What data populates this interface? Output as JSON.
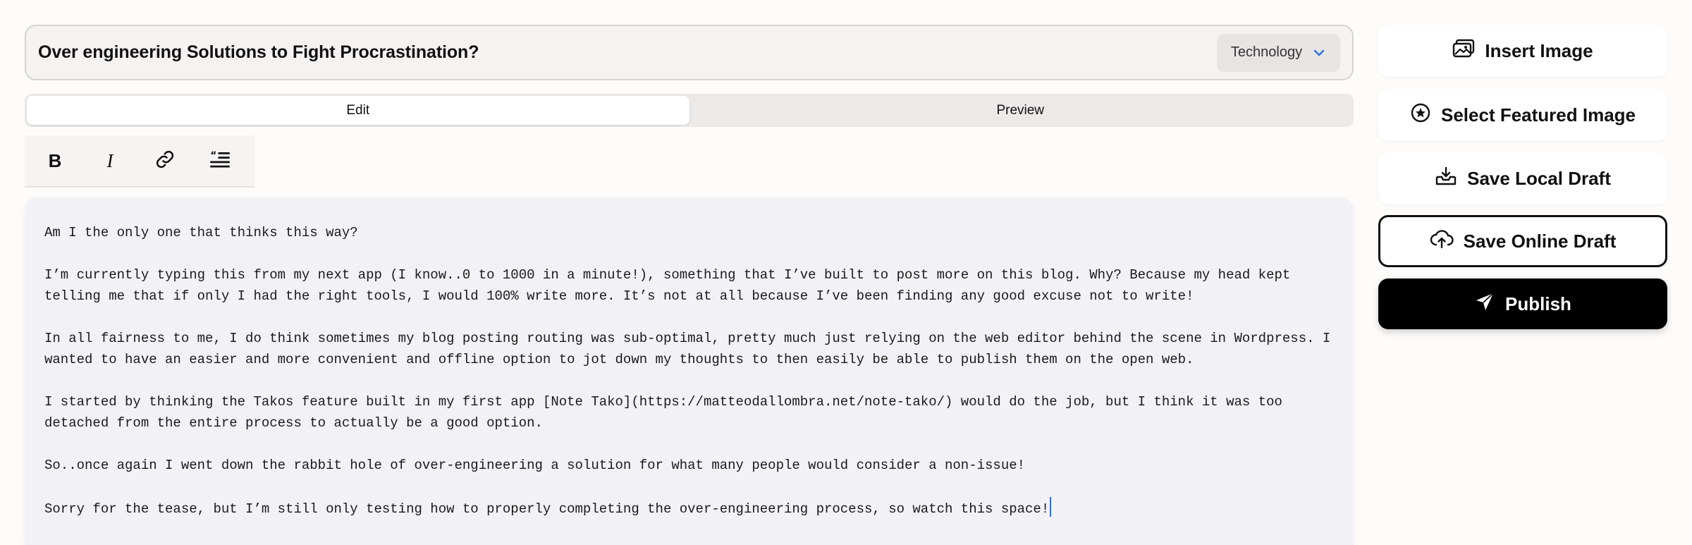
{
  "header": {
    "title": "Over engineering Solutions to Fight Procrastination?",
    "category": "Technology"
  },
  "tabs": [
    {
      "label": "Edit",
      "active": true
    },
    {
      "label": "Preview",
      "active": false
    }
  ],
  "toolbar": {
    "bold": "B",
    "italic": "I",
    "link_icon": "link-icon",
    "quote_icon": "blockquote-icon"
  },
  "editor": {
    "paragraphs": [
      "Am I the only one that thinks this way?",
      "I’m currently typing this from my next app (I know..0 to 1000 in a minute!), something that I’ve built to post more on this blog. Why? Because my head kept telling me that if only I had the right tools, I would 100% write more. It’s not at all because I’ve been finding any good excuse not to write!",
      "In all fairness to me, I do think sometimes my blog posting routing was sub-optimal, pretty much just relying on the web editor behind the scene in Wordpress. I wanted to have an easier and more convenient and offline option to jot down my thoughts to then easily be able to publish them on the open web.",
      "I started by thinking the Takos feature built in my first app [Note Tako](https://matteodallombra.net/note-tako/) would do the job, but I think it was too detached from the entire process to actually be a good option.",
      "So..once again I went down the rabbit hole of over-engineering a solution for what many people would consider a non-issue!",
      "Sorry for the tease, but I’m still only testing how to properly completing the over-engineering process, so watch this space!"
    ]
  },
  "sidebar": {
    "insert_image": "Insert Image",
    "select_featured": "Select Featured Image",
    "save_local": "Save Local Draft",
    "save_online": "Save Online Draft",
    "publish": "Publish"
  },
  "colors": {
    "accent_blue": "#2f6fdb",
    "publish_bg": "#000000",
    "editor_bg": "#f2f1f6"
  }
}
